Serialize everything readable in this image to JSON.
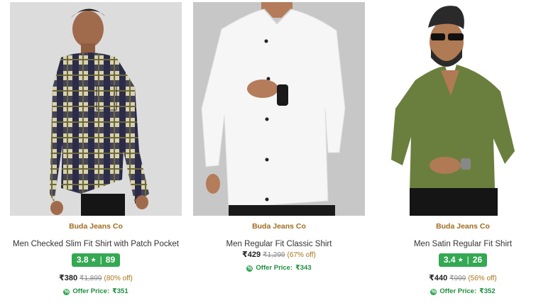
{
  "products": [
    {
      "brand": "Buda Jeans Co",
      "title": "Men Checked Slim Fit Shirt with Patch Pocket",
      "rating": "3.8",
      "rating_count": "89",
      "price": "₹380",
      "mrp": "₹1,899",
      "discount": "(80% off)",
      "offer_label": "Offer Price:",
      "offer_price": "₹351"
    },
    {
      "brand": "Buda Jeans Co",
      "title": "Men Regular Fit Classic Shirt",
      "price": "₹429",
      "mrp": "₹1,299",
      "discount": "(67% off)",
      "offer_label": "Offer Price:",
      "offer_price": "₹343"
    },
    {
      "brand": "Buda Jeans Co",
      "title": "Men Satin Regular Fit Shirt",
      "rating": "3.4",
      "rating_count": "26",
      "price": "₹440",
      "mrp": "₹999",
      "discount": "(56% off)",
      "offer_label": "Offer Price:",
      "offer_price": "₹352"
    }
  ],
  "icons": {
    "star": "★",
    "sep": "|",
    "offer": "%"
  },
  "colors": {
    "brand": "#a16c1f",
    "rating_bg": "#34a853",
    "offer": "#1e8e3e"
  }
}
